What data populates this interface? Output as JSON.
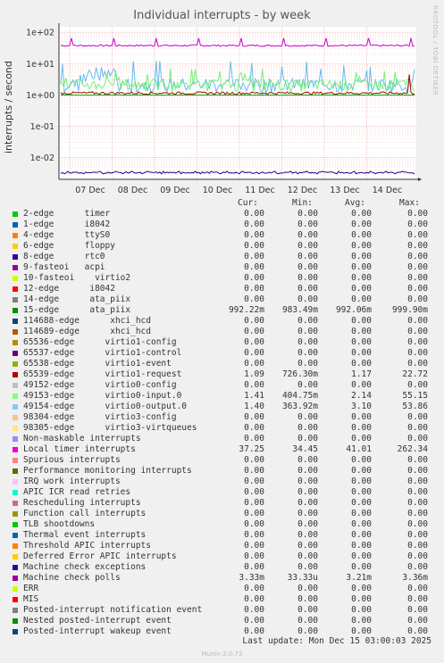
{
  "title": "Individual interrupts - by week",
  "side_text": "RRDTOOL / TOBI OETIKER",
  "footer": {
    "last_update": "Last update: Mon Dec 15 03:00:03 2025",
    "version": "Munin 2.0.73"
  },
  "legend_headers": [
    "Cur:",
    "Min:",
    "Avg:",
    "Max:"
  ],
  "chart_data": {
    "type": "line",
    "title": "Individual interrupts - by week",
    "ylabel": "interrupts / second",
    "yscale": "log",
    "ylim": [
      0.002,
      150
    ],
    "yticks": [
      "1e+02",
      "1e+01",
      "1e+00",
      "1e-01",
      "1e-02"
    ],
    "xticks": [
      "07 Dec",
      "08 Dec",
      "09 Dec",
      "10 Dec",
      "11 Dec",
      "12 Dec",
      "13 Dec",
      "14 Dec"
    ],
    "grid": true,
    "series": [
      {
        "name": "Local timer interrupts",
        "color": "#cc00cc",
        "typical": 37.25,
        "spikes": 65
      },
      {
        "name": "virtio0-output.0",
        "color": "#66bbee",
        "typical": 1.4,
        "spikes": 12
      },
      {
        "name": "virtio0-input.0",
        "color": "#77ee77",
        "typical": 1.41,
        "spikes": 7
      },
      {
        "name": "virtio1-request",
        "color": "#aa0000",
        "typical": 1.09,
        "spikes": 1.4
      },
      {
        "name": "ata_piix",
        "color": "#00aa00",
        "typical": 0.992,
        "spikes": 1.0
      },
      {
        "name": "Machine check polls",
        "color": "#220088",
        "typical": 0.0033,
        "spikes": 0.0036
      }
    ]
  },
  "legend": [
    {
      "name": "2-edge      timer",
      "color": "#00cc00",
      "cur": "0.00",
      "min": "0.00",
      "avg": "0.00",
      "max": "0.00"
    },
    {
      "name": "1-edge      i8042",
      "color": "#0066b3",
      "cur": "0.00",
      "min": "0.00",
      "avg": "0.00",
      "max": "0.00"
    },
    {
      "name": "4-edge      ttyS0",
      "color": "#ff8000",
      "cur": "0.00",
      "min": "0.00",
      "avg": "0.00",
      "max": "0.00"
    },
    {
      "name": "6-edge      floppy",
      "color": "#ffcc00",
      "cur": "0.00",
      "min": "0.00",
      "avg": "0.00",
      "max": "0.00"
    },
    {
      "name": "8-edge      rtc0",
      "color": "#330099",
      "cur": "0.00",
      "min": "0.00",
      "avg": "0.00",
      "max": "0.00"
    },
    {
      "name": "9-fasteoi   acpi",
      "color": "#990099",
      "cur": "0.00",
      "min": "0.00",
      "avg": "0.00",
      "max": "0.00"
    },
    {
      "name": "10-fasteoi    virtio2",
      "color": "#ccff00",
      "cur": "0.00",
      "min": "0.00",
      "avg": "0.00",
      "max": "0.00"
    },
    {
      "name": "12-edge      i8042",
      "color": "#ff0000",
      "cur": "0.00",
      "min": "0.00",
      "avg": "0.00",
      "max": "0.00"
    },
    {
      "name": "14-edge      ata_piix",
      "color": "#808080",
      "cur": "0.00",
      "min": "0.00",
      "avg": "0.00",
      "max": "0.00"
    },
    {
      "name": "15-edge      ata_piix",
      "color": "#008f00",
      "cur": "992.22m",
      "min": "983.49m",
      "avg": "992.06m",
      "max": "999.90m"
    },
    {
      "name": "114688-edge      xhci_hcd",
      "color": "#00487d",
      "cur": "0.00",
      "min": "0.00",
      "avg": "0.00",
      "max": "0.00"
    },
    {
      "name": "114689-edge      xhci_hcd",
      "color": "#b35a00",
      "cur": "0.00",
      "min": "0.00",
      "avg": "0.00",
      "max": "0.00"
    },
    {
      "name": "65536-edge      virtio1-config",
      "color": "#b38f00",
      "cur": "0.00",
      "min": "0.00",
      "avg": "0.00",
      "max": "0.00"
    },
    {
      "name": "65537-edge      virtio1-control",
      "color": "#6b006b",
      "cur": "0.00",
      "min": "0.00",
      "avg": "0.00",
      "max": "0.00"
    },
    {
      "name": "65538-edge      virtio1-event",
      "color": "#8fb300",
      "cur": "0.00",
      "min": "0.00",
      "avg": "0.00",
      "max": "0.00"
    },
    {
      "name": "65539-edge      virtio1-request",
      "color": "#b30000",
      "cur": "1.09",
      "min": "726.30m",
      "avg": "1.17",
      "max": "22.72"
    },
    {
      "name": "49152-edge      virtio0-config",
      "color": "#bebebe",
      "cur": "0.00",
      "min": "0.00",
      "avg": "0.00",
      "max": "0.00"
    },
    {
      "name": "49153-edge      virtio0-input.0",
      "color": "#80ff80",
      "cur": "1.41",
      "min": "404.75m",
      "avg": "2.14",
      "max": "55.15"
    },
    {
      "name": "49154-edge      virtio0-output.0",
      "color": "#80c9ff",
      "cur": "1.40",
      "min": "363.92m",
      "avg": "3.10",
      "max": "53.86"
    },
    {
      "name": "98304-edge      virtio3-config",
      "color": "#ffc080",
      "cur": "0.00",
      "min": "0.00",
      "avg": "0.00",
      "max": "0.00"
    },
    {
      "name": "98305-edge      virtio3-virtqueues",
      "color": "#ffe680",
      "cur": "0.00",
      "min": "0.00",
      "avg": "0.00",
      "max": "0.00"
    },
    {
      "name": "Non-maskable interrupts",
      "color": "#aa80ff",
      "cur": "0.00",
      "min": "0.00",
      "avg": "0.00",
      "max": "0.00"
    },
    {
      "name": "Local timer interrupts",
      "color": "#ee00cc",
      "cur": "37.25",
      "min": "34.45",
      "avg": "41.01",
      "max": "262.34"
    },
    {
      "name": "Spurious interrupts",
      "color": "#ff8080",
      "cur": "0.00",
      "min": "0.00",
      "avg": "0.00",
      "max": "0.00"
    },
    {
      "name": "Performance monitoring interrupts",
      "color": "#666600",
      "cur": "0.00",
      "min": "0.00",
      "avg": "0.00",
      "max": "0.00"
    },
    {
      "name": "IRQ work interrupts",
      "color": "#ffbfff",
      "cur": "0.00",
      "min": "0.00",
      "avg": "0.00",
      "max": "0.00"
    },
    {
      "name": "APIC ICR read retries",
      "color": "#00ffcc",
      "cur": "0.00",
      "min": "0.00",
      "avg": "0.00",
      "max": "0.00"
    },
    {
      "name": "Rescheduling interrupts",
      "color": "#cc6699",
      "cur": "0.00",
      "min": "0.00",
      "avg": "0.00",
      "max": "0.00"
    },
    {
      "name": "Function call interrupts",
      "color": "#999900",
      "cur": "0.00",
      "min": "0.00",
      "avg": "0.00",
      "max": "0.00"
    },
    {
      "name": "TLB shootdowns",
      "color": "#00cc00",
      "cur": "0.00",
      "min": "0.00",
      "avg": "0.00",
      "max": "0.00"
    },
    {
      "name": "Thermal event interrupts",
      "color": "#0066b3",
      "cur": "0.00",
      "min": "0.00",
      "avg": "0.00",
      "max": "0.00"
    },
    {
      "name": "Threshold APIC interrupts",
      "color": "#ff8000",
      "cur": "0.00",
      "min": "0.00",
      "avg": "0.00",
      "max": "0.00"
    },
    {
      "name": "Deferred Error APIC interrupts",
      "color": "#ffcc00",
      "cur": "0.00",
      "min": "0.00",
      "avg": "0.00",
      "max": "0.00"
    },
    {
      "name": "Machine check exceptions",
      "color": "#330099",
      "cur": "0.00",
      "min": "0.00",
      "avg": "0.00",
      "max": "0.00"
    },
    {
      "name": "Machine check polls",
      "color": "#990099",
      "cur": "3.33m",
      "min": "33.33u",
      "avg": "3.21m",
      "max": "3.36m"
    },
    {
      "name": "ERR",
      "color": "#ccff00",
      "cur": "0.00",
      "min": "0.00",
      "avg": "0.00",
      "max": "0.00"
    },
    {
      "name": "MIS",
      "color": "#ff0000",
      "cur": "0.00",
      "min": "0.00",
      "avg": "0.00",
      "max": "0.00"
    },
    {
      "name": "Posted-interrupt notification event",
      "color": "#808080",
      "cur": "0.00",
      "min": "0.00",
      "avg": "0.00",
      "max": "0.00"
    },
    {
      "name": "Nested posted-interrupt event",
      "color": "#008f00",
      "cur": "0.00",
      "min": "0.00",
      "avg": "0.00",
      "max": "0.00"
    },
    {
      "name": "Posted-interrupt wakeup event",
      "color": "#00487d",
      "cur": "0.00",
      "min": "0.00",
      "avg": "0.00",
      "max": "0.00"
    }
  ]
}
